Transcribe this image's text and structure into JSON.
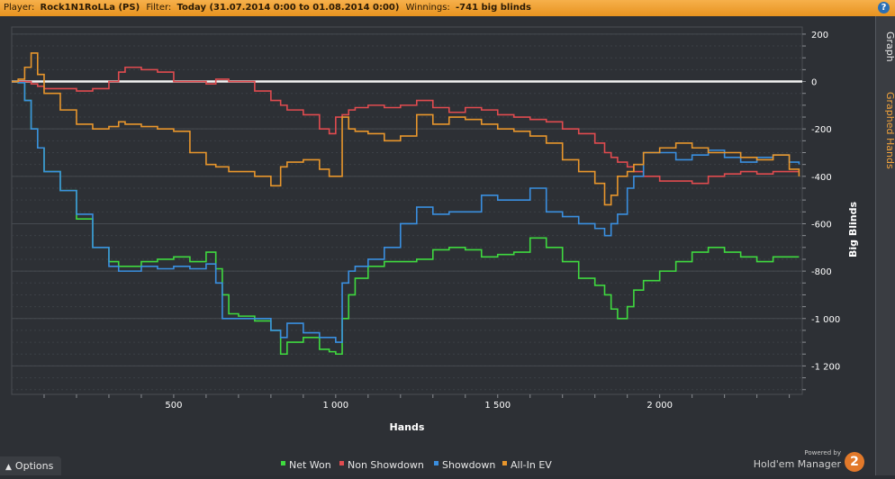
{
  "header": {
    "player_label": "Player:",
    "player_value": "Rock1N1RoLLa (PS)",
    "filter_label": "Filter:",
    "filter_value": "Today (31.07.2014 0:00 to 01.08.2014 0:00)",
    "winnings_label": "Winnings:",
    "winnings_value": "-741 big blinds",
    "help_icon": "question-icon",
    "accent_color": "#f0a23c"
  },
  "sidebar": {
    "tabs": [
      {
        "label": "Graph",
        "active": true
      },
      {
        "label": "Graphed Hands",
        "active": false
      }
    ]
  },
  "footer": {
    "options_label": "Options",
    "options_icon": "chevron-up-icon",
    "powered_by": "Powered by",
    "brand_name": "Hold'em Manager",
    "brand_badge": "2"
  },
  "chart_data": {
    "type": "line",
    "title": "",
    "xlabel": "Hands",
    "ylabel": "Big Blinds",
    "xlim": [
      0,
      2440
    ],
    "ylim": [
      -1320,
      230
    ],
    "x_ticks": [
      {
        "value": 500,
        "label": "500"
      },
      {
        "value": 1000,
        "label": "1 000"
      },
      {
        "value": 1500,
        "label": "1 500"
      },
      {
        "value": 2000,
        "label": "2 000"
      }
    ],
    "y_ticks": [
      {
        "value": 200,
        "label": "200"
      },
      {
        "value": 0,
        "label": "0"
      },
      {
        "value": -200,
        "label": "-200"
      },
      {
        "value": -400,
        "label": "-400"
      },
      {
        "value": -600,
        "label": "-600"
      },
      {
        "value": -800,
        "label": "-800"
      },
      {
        "value": -1000,
        "label": "-1 000"
      },
      {
        "value": -1200,
        "label": "-1 200"
      }
    ],
    "grid": true,
    "zero_line": true,
    "legend_position": "bottom-center",
    "x": [
      0,
      20,
      40,
      60,
      80,
      100,
      150,
      200,
      250,
      300,
      330,
      350,
      400,
      450,
      500,
      550,
      600,
      630,
      650,
      670,
      700,
      750,
      800,
      830,
      850,
      900,
      950,
      980,
      1000,
      1020,
      1040,
      1060,
      1100,
      1150,
      1200,
      1250,
      1300,
      1350,
      1400,
      1450,
      1500,
      1550,
      1600,
      1650,
      1700,
      1750,
      1800,
      1830,
      1850,
      1870,
      1900,
      1920,
      1950,
      2000,
      2050,
      2100,
      2150,
      2200,
      2250,
      2300,
      2350,
      2400,
      2430
    ],
    "series": [
      {
        "name": "Net Won",
        "color": "#3fd93f",
        "values": [
          0,
          -5,
          -80,
          -200,
          -280,
          -380,
          -460,
          -580,
          -700,
          -760,
          -780,
          -780,
          -760,
          -750,
          -740,
          -760,
          -720,
          -790,
          -900,
          -980,
          -990,
          -1010,
          -1050,
          -1150,
          -1100,
          -1080,
          -1130,
          -1140,
          -1150,
          -1000,
          -900,
          -830,
          -780,
          -760,
          -760,
          -750,
          -710,
          -700,
          -710,
          -740,
          -730,
          -720,
          -660,
          -700,
          -760,
          -830,
          -860,
          -900,
          -960,
          -1000,
          -950,
          -880,
          -840,
          -800,
          -760,
          -720,
          -700,
          -720,
          -740,
          -760,
          -740,
          -740,
          -740
        ]
      },
      {
        "name": "Non Showdown",
        "color": "#e04b4f",
        "values": [
          0,
          0,
          0,
          -10,
          -20,
          -30,
          -30,
          -40,
          -30,
          0,
          40,
          60,
          50,
          40,
          0,
          0,
          -10,
          10,
          10,
          0,
          0,
          -40,
          -80,
          -100,
          -120,
          -140,
          -200,
          -220,
          -150,
          -140,
          -120,
          -110,
          -100,
          -110,
          -100,
          -80,
          -110,
          -130,
          -110,
          -120,
          -140,
          -150,
          -160,
          -170,
          -200,
          -220,
          -260,
          -300,
          -320,
          -340,
          -360,
          -380,
          -400,
          -420,
          -420,
          -430,
          -400,
          -390,
          -380,
          -390,
          -380,
          -380,
          -380
        ]
      },
      {
        "name": "Showdown",
        "color": "#3a8fe0",
        "values": [
          0,
          -5,
          -80,
          -200,
          -280,
          -380,
          -460,
          -560,
          -700,
          -780,
          -800,
          -800,
          -780,
          -790,
          -780,
          -790,
          -770,
          -850,
          -1000,
          -1000,
          -1000,
          -1000,
          -1050,
          -1080,
          -1020,
          -1060,
          -1080,
          -1080,
          -1100,
          -850,
          -800,
          -780,
          -750,
          -700,
          -600,
          -530,
          -560,
          -550,
          -550,
          -480,
          -500,
          -500,
          -450,
          -550,
          -570,
          -600,
          -620,
          -650,
          -600,
          -560,
          -450,
          -400,
          -300,
          -300,
          -330,
          -310,
          -290,
          -320,
          -340,
          -320,
          -310,
          -340,
          -350
        ]
      },
      {
        "name": "All-In EV",
        "color": "#e8962c",
        "values": [
          0,
          10,
          60,
          120,
          30,
          -50,
          -120,
          -180,
          -200,
          -190,
          -170,
          -180,
          -190,
          -200,
          -210,
          -300,
          -350,
          -360,
          -360,
          -380,
          -380,
          -400,
          -440,
          -360,
          -340,
          -330,
          -370,
          -400,
          -400,
          -150,
          -200,
          -210,
          -220,
          -250,
          -230,
          -140,
          -180,
          -150,
          -160,
          -180,
          -200,
          -210,
          -230,
          -260,
          -330,
          -380,
          -430,
          -520,
          -480,
          -400,
          -380,
          -350,
          -300,
          -280,
          -260,
          -280,
          -300,
          -300,
          -320,
          -330,
          -310,
          -370,
          -400
        ]
      }
    ]
  }
}
